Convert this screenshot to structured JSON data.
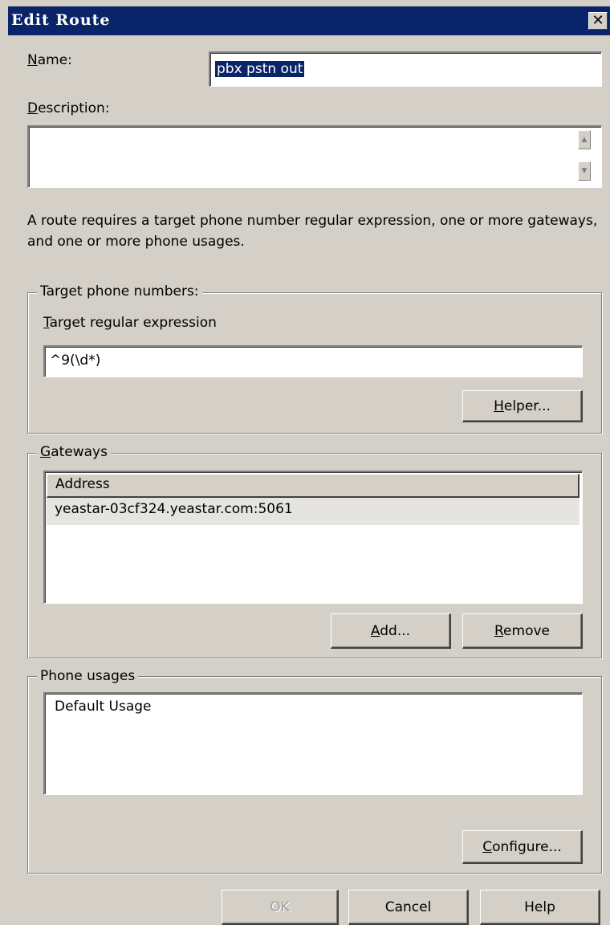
{
  "window": {
    "title": "Edit Route",
    "close_glyph": "✕"
  },
  "name": {
    "label_u": "N",
    "label_rest": "ame:",
    "value": "pbx pstn out"
  },
  "description": {
    "label_u": "D",
    "label_rest": "escription:",
    "value": ""
  },
  "info_text": "A route requires a target phone number regular expression, one or more gateways, and one or more phone usages.",
  "target": {
    "group_title": "Target phone numbers:",
    "label_u": "T",
    "label_rest": "arget regular expression",
    "value": "^9(\\d*)",
    "helper_u": "H",
    "helper_rest": "elper..."
  },
  "gateways": {
    "title_u": "G",
    "title_rest": "ateways",
    "column_header": "Address",
    "rows": [
      "yeastar-03cf324.yeastar.com:5061"
    ],
    "add_u": "A",
    "add_rest": "dd...",
    "remove_u": "R",
    "remove_rest": "emove"
  },
  "usages": {
    "group_title": "Phone usages",
    "items": [
      "Default Usage"
    ],
    "configure_u": "C",
    "configure_rest": "onfigure..."
  },
  "footer": {
    "ok": "OK",
    "cancel": "Cancel",
    "help": "Help"
  }
}
